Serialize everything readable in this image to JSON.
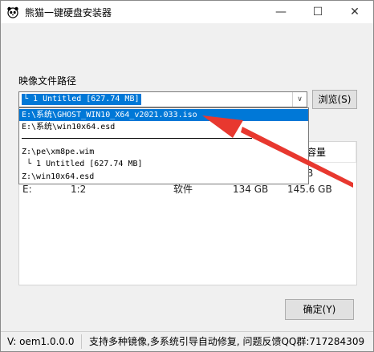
{
  "window": {
    "title": "熊猫一键硬盘安装器",
    "app_icon": "panda-icon",
    "controls": {
      "minimize": "—",
      "maximize": "☐",
      "close": "✕"
    }
  },
  "image_path": {
    "label": "映像文件路径",
    "selected": "└ 1 Untitled [627.74 MB]",
    "dropdown_arrow": "∨",
    "browse_label": "浏览(S)",
    "options": [
      "E:\\系统\\GHOST_WIN10_X64_v2021.033.iso",
      "E:\\系统\\win10x64.esd",
      "",
      "Z:\\pe\\xm8pe.wim",
      " └ 1 Untitled [627.74 MB]",
      "Z:\\win10x64.esd"
    ],
    "highlighted_index": 0
  },
  "partition_table": {
    "headers": [
      "",
      "",
      "",
      "",
      "容量"
    ],
    "rows": [
      {
        "drive": "",
        "part": "",
        "label": "",
        "free": "",
        "size": "B"
      },
      {
        "drive": "E:",
        "part": "1:2",
        "label": "软件",
        "free": "134 GB",
        "size": "145.6 GB"
      }
    ]
  },
  "confirm_label": "确定(Y)",
  "status_bar": {
    "version": "V:  oem1.0.0.0",
    "message": "支持多种镜像,多系统引导自动修复, 问题反馈QQ群:717284309"
  },
  "colors": {
    "selection": "#0078d7",
    "annotation_arrow": "#e8382f"
  }
}
